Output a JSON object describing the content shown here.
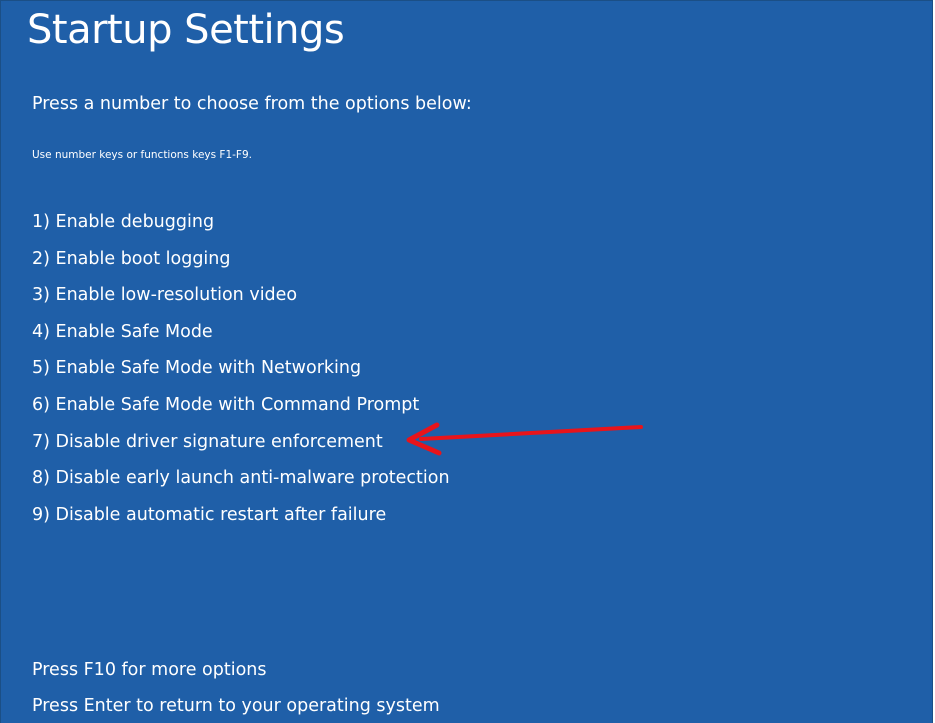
{
  "screen": {
    "title": "Startup Settings",
    "prompt": "Press a number to choose from the options below:",
    "hint": "Use number keys or functions keys F1-F9.",
    "options": [
      {
        "label": "1) Enable debugging"
      },
      {
        "label": "2) Enable boot logging"
      },
      {
        "label": "3) Enable low-resolution video"
      },
      {
        "label": "4) Enable Safe Mode"
      },
      {
        "label": "5) Enable Safe Mode with Networking"
      },
      {
        "label": "6) Enable Safe Mode with Command Prompt"
      },
      {
        "label": "7) Disable driver signature enforcement"
      },
      {
        "label": "8) Disable early launch anti-malware protection"
      },
      {
        "label": "9) Disable automatic restart after failure"
      }
    ],
    "footer": {
      "more_options": "Press F10 for more options",
      "return": "Press Enter to return to your operating system"
    }
  },
  "annotation": {
    "icon": "red-arrow-icon",
    "color": "#e8141b",
    "points_to_option_index": 6
  },
  "colors": {
    "background": "#1f5fa8",
    "text": "#ffffff"
  }
}
